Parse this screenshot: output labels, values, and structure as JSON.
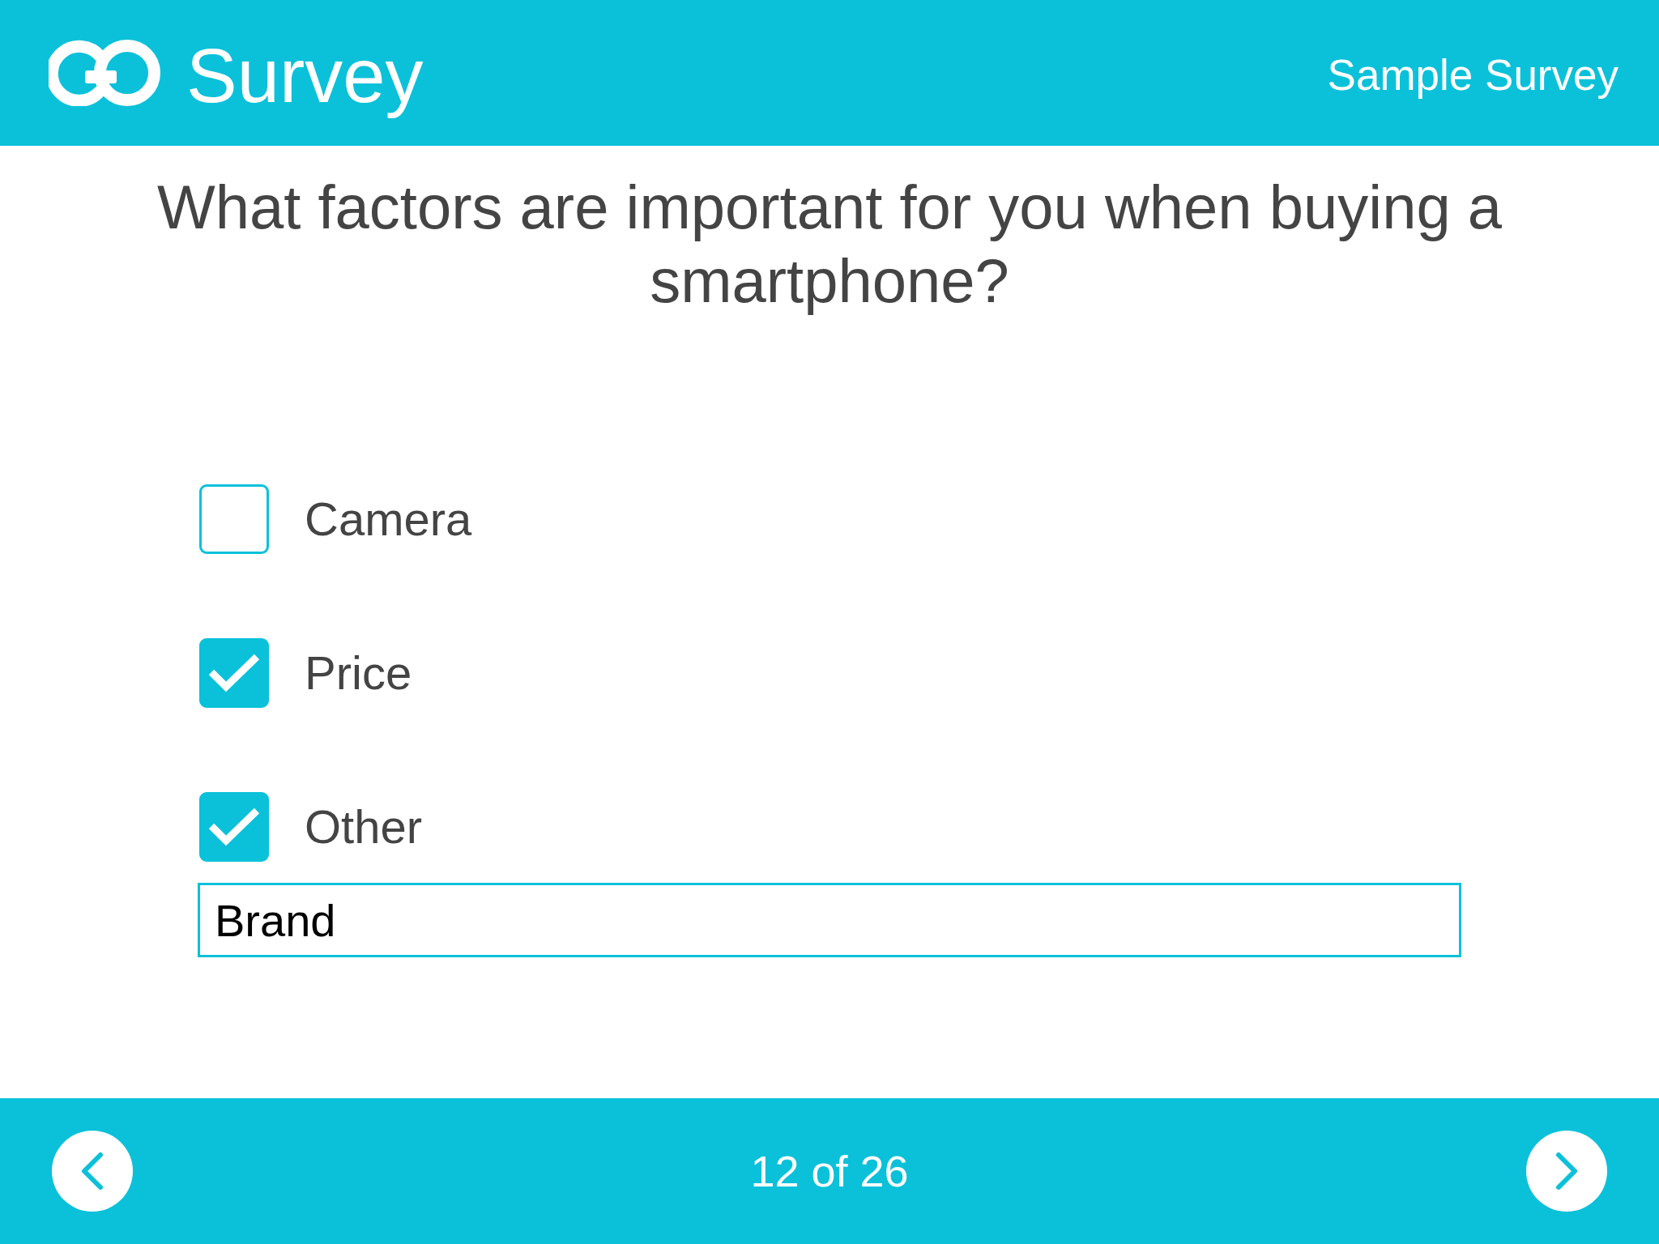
{
  "header": {
    "logo_text": "Survey",
    "survey_title": "Sample Survey"
  },
  "question": "What factors are important for you when buying a smartphone?",
  "options": [
    {
      "label": "Camera",
      "checked": false
    },
    {
      "label": "Price",
      "checked": true
    },
    {
      "label": "Other",
      "checked": true
    }
  ],
  "other_input": {
    "value": "Brand"
  },
  "footer": {
    "progress": "12 of 26"
  }
}
